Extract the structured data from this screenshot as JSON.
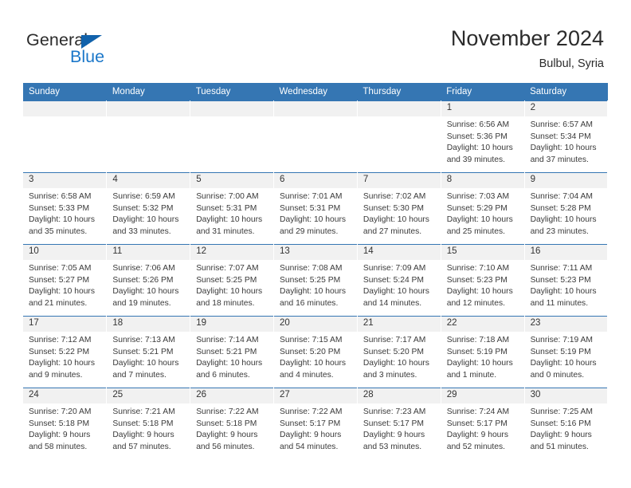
{
  "brand": {
    "name_part1": "General",
    "name_part2": "Blue",
    "triangle_color": "#1162ab",
    "blue_color": "#1b77c9"
  },
  "header": {
    "title": "November 2024",
    "subtitle": "Bulbul, Syria"
  },
  "theme": {
    "header_blue": "#3576b3",
    "cell_band_gray": "#f1f1f1",
    "text": "#333333"
  },
  "weekdays": [
    "Sunday",
    "Monday",
    "Tuesday",
    "Wednesday",
    "Thursday",
    "Friday",
    "Saturday"
  ],
  "labels": {
    "sunrise_prefix": "Sunrise:",
    "sunset_prefix": "Sunset:",
    "daylight_prefix": "Daylight:"
  },
  "calendar": {
    "month": "November",
    "year": "2024",
    "location": "Bulbul, Syria",
    "weeks": [
      [
        {
          "day": "",
          "empty": true
        },
        {
          "day": "",
          "empty": true
        },
        {
          "day": "",
          "empty": true
        },
        {
          "day": "",
          "empty": true
        },
        {
          "day": "",
          "empty": true
        },
        {
          "day": "1",
          "sunrise": "Sunrise: 6:56 AM",
          "sunset": "Sunset: 5:36 PM",
          "daylight": "Daylight: 10 hours and 39 minutes."
        },
        {
          "day": "2",
          "sunrise": "Sunrise: 6:57 AM",
          "sunset": "Sunset: 5:34 PM",
          "daylight": "Daylight: 10 hours and 37 minutes."
        }
      ],
      [
        {
          "day": "3",
          "sunrise": "Sunrise: 6:58 AM",
          "sunset": "Sunset: 5:33 PM",
          "daylight": "Daylight: 10 hours and 35 minutes."
        },
        {
          "day": "4",
          "sunrise": "Sunrise: 6:59 AM",
          "sunset": "Sunset: 5:32 PM",
          "daylight": "Daylight: 10 hours and 33 minutes."
        },
        {
          "day": "5",
          "sunrise": "Sunrise: 7:00 AM",
          "sunset": "Sunset: 5:31 PM",
          "daylight": "Daylight: 10 hours and 31 minutes."
        },
        {
          "day": "6",
          "sunrise": "Sunrise: 7:01 AM",
          "sunset": "Sunset: 5:31 PM",
          "daylight": "Daylight: 10 hours and 29 minutes."
        },
        {
          "day": "7",
          "sunrise": "Sunrise: 7:02 AM",
          "sunset": "Sunset: 5:30 PM",
          "daylight": "Daylight: 10 hours and 27 minutes."
        },
        {
          "day": "8",
          "sunrise": "Sunrise: 7:03 AM",
          "sunset": "Sunset: 5:29 PM",
          "daylight": "Daylight: 10 hours and 25 minutes."
        },
        {
          "day": "9",
          "sunrise": "Sunrise: 7:04 AM",
          "sunset": "Sunset: 5:28 PM",
          "daylight": "Daylight: 10 hours and 23 minutes."
        }
      ],
      [
        {
          "day": "10",
          "sunrise": "Sunrise: 7:05 AM",
          "sunset": "Sunset: 5:27 PM",
          "daylight": "Daylight: 10 hours and 21 minutes."
        },
        {
          "day": "11",
          "sunrise": "Sunrise: 7:06 AM",
          "sunset": "Sunset: 5:26 PM",
          "daylight": "Daylight: 10 hours and 19 minutes."
        },
        {
          "day": "12",
          "sunrise": "Sunrise: 7:07 AM",
          "sunset": "Sunset: 5:25 PM",
          "daylight": "Daylight: 10 hours and 18 minutes."
        },
        {
          "day": "13",
          "sunrise": "Sunrise: 7:08 AM",
          "sunset": "Sunset: 5:25 PM",
          "daylight": "Daylight: 10 hours and 16 minutes."
        },
        {
          "day": "14",
          "sunrise": "Sunrise: 7:09 AM",
          "sunset": "Sunset: 5:24 PM",
          "daylight": "Daylight: 10 hours and 14 minutes."
        },
        {
          "day": "15",
          "sunrise": "Sunrise: 7:10 AM",
          "sunset": "Sunset: 5:23 PM",
          "daylight": "Daylight: 10 hours and 12 minutes."
        },
        {
          "day": "16",
          "sunrise": "Sunrise: 7:11 AM",
          "sunset": "Sunset: 5:23 PM",
          "daylight": "Daylight: 10 hours and 11 minutes."
        }
      ],
      [
        {
          "day": "17",
          "sunrise": "Sunrise: 7:12 AM",
          "sunset": "Sunset: 5:22 PM",
          "daylight": "Daylight: 10 hours and 9 minutes."
        },
        {
          "day": "18",
          "sunrise": "Sunrise: 7:13 AM",
          "sunset": "Sunset: 5:21 PM",
          "daylight": "Daylight: 10 hours and 7 minutes."
        },
        {
          "day": "19",
          "sunrise": "Sunrise: 7:14 AM",
          "sunset": "Sunset: 5:21 PM",
          "daylight": "Daylight: 10 hours and 6 minutes."
        },
        {
          "day": "20",
          "sunrise": "Sunrise: 7:15 AM",
          "sunset": "Sunset: 5:20 PM",
          "daylight": "Daylight: 10 hours and 4 minutes."
        },
        {
          "day": "21",
          "sunrise": "Sunrise: 7:17 AM",
          "sunset": "Sunset: 5:20 PM",
          "daylight": "Daylight: 10 hours and 3 minutes."
        },
        {
          "day": "22",
          "sunrise": "Sunrise: 7:18 AM",
          "sunset": "Sunset: 5:19 PM",
          "daylight": "Daylight: 10 hours and 1 minute."
        },
        {
          "day": "23",
          "sunrise": "Sunrise: 7:19 AM",
          "sunset": "Sunset: 5:19 PM",
          "daylight": "Daylight: 10 hours and 0 minutes."
        }
      ],
      [
        {
          "day": "24",
          "sunrise": "Sunrise: 7:20 AM",
          "sunset": "Sunset: 5:18 PM",
          "daylight": "Daylight: 9 hours and 58 minutes."
        },
        {
          "day": "25",
          "sunrise": "Sunrise: 7:21 AM",
          "sunset": "Sunset: 5:18 PM",
          "daylight": "Daylight: 9 hours and 57 minutes."
        },
        {
          "day": "26",
          "sunrise": "Sunrise: 7:22 AM",
          "sunset": "Sunset: 5:18 PM",
          "daylight": "Daylight: 9 hours and 56 minutes."
        },
        {
          "day": "27",
          "sunrise": "Sunrise: 7:22 AM",
          "sunset": "Sunset: 5:17 PM",
          "daylight": "Daylight: 9 hours and 54 minutes."
        },
        {
          "day": "28",
          "sunrise": "Sunrise: 7:23 AM",
          "sunset": "Sunset: 5:17 PM",
          "daylight": "Daylight: 9 hours and 53 minutes."
        },
        {
          "day": "29",
          "sunrise": "Sunrise: 7:24 AM",
          "sunset": "Sunset: 5:17 PM",
          "daylight": "Daylight: 9 hours and 52 minutes."
        },
        {
          "day": "30",
          "sunrise": "Sunrise: 7:25 AM",
          "sunset": "Sunset: 5:16 PM",
          "daylight": "Daylight: 9 hours and 51 minutes."
        }
      ]
    ]
  }
}
